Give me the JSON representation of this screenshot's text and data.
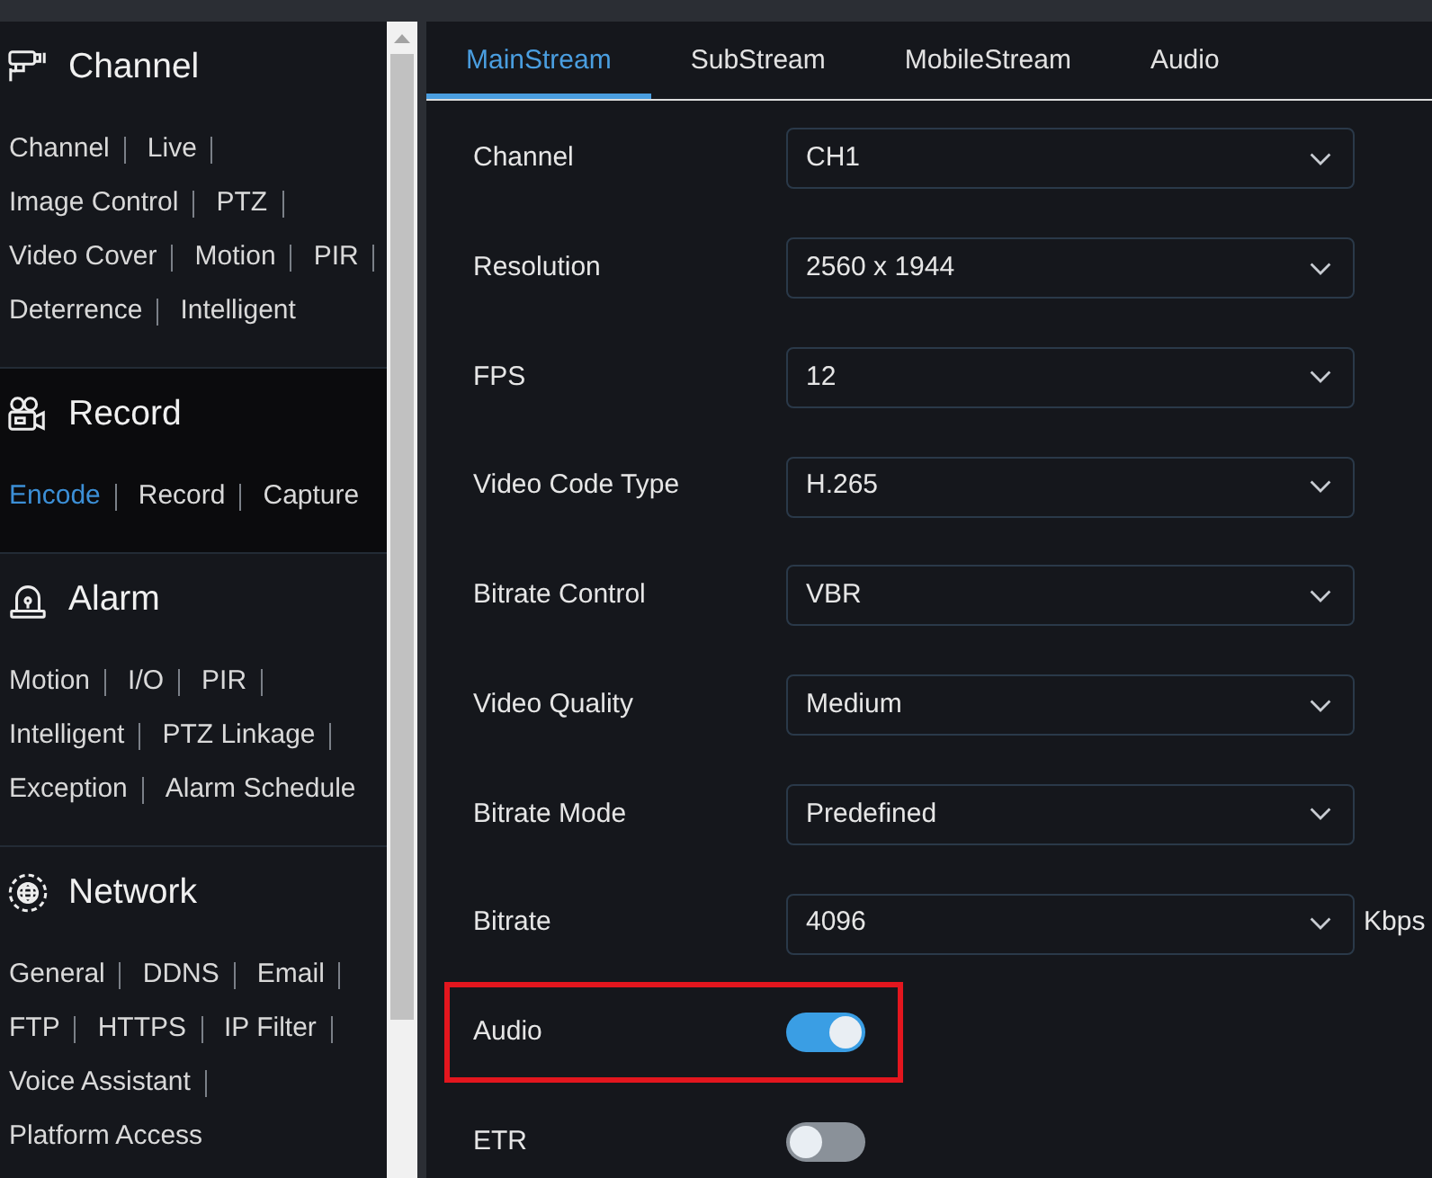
{
  "sidebar": {
    "sections": [
      {
        "kind": "channel",
        "title": "Channel",
        "selected": false,
        "lines": [
          [
            {
              "label": "Channel",
              "selected": false
            },
            {
              "label": "Live",
              "selected": false
            }
          ],
          [
            {
              "label": "Image Control",
              "selected": false
            },
            {
              "label": "PTZ",
              "selected": false
            }
          ],
          [
            {
              "label": "Video Cover",
              "selected": false
            },
            {
              "label": "Motion",
              "selected": false
            },
            {
              "label": "PIR",
              "selected": false
            }
          ],
          [
            {
              "label": "Deterrence",
              "selected": false
            },
            {
              "label": "Intelligent",
              "selected": false
            }
          ]
        ]
      },
      {
        "kind": "record",
        "title": "Record",
        "selected": true,
        "lines": [
          [
            {
              "label": "Encode",
              "selected": true
            },
            {
              "label": "Record",
              "selected": false
            },
            {
              "label": "Capture",
              "selected": false
            }
          ]
        ]
      },
      {
        "kind": "alarm",
        "title": "Alarm",
        "selected": false,
        "lines": [
          [
            {
              "label": "Motion",
              "selected": false
            },
            {
              "label": "I/O",
              "selected": false
            },
            {
              "label": "PIR",
              "selected": false
            }
          ],
          [
            {
              "label": "Intelligent",
              "selected": false
            },
            {
              "label": "PTZ Linkage",
              "selected": false
            }
          ],
          [
            {
              "label": "Exception",
              "selected": false
            },
            {
              "label": "Alarm Schedule",
              "selected": false
            }
          ]
        ]
      },
      {
        "kind": "network",
        "title": "Network",
        "selected": false,
        "lines": [
          [
            {
              "label": "General",
              "selected": false
            },
            {
              "label": "DDNS",
              "selected": false
            },
            {
              "label": "Email",
              "selected": false
            }
          ],
          [
            {
              "label": "FTP",
              "selected": false
            },
            {
              "label": "HTTPS",
              "selected": false
            },
            {
              "label": "IP Filter",
              "selected": false
            }
          ],
          [
            {
              "label": "Voice Assistant",
              "selected": false
            }
          ],
          [
            {
              "label": "Platform Access",
              "selected": false
            }
          ]
        ]
      }
    ]
  },
  "tabs": [
    {
      "label": "MainStream",
      "selected": true
    },
    {
      "label": "SubStream",
      "selected": false
    },
    {
      "label": "MobileStream",
      "selected": false
    },
    {
      "label": "Audio",
      "selected": false
    }
  ],
  "fields": [
    {
      "kind": "select",
      "label": "Channel",
      "value": "CH1",
      "highlighted": false
    },
    {
      "kind": "select",
      "label": "Resolution",
      "value": "2560 x 1944",
      "highlighted": false
    },
    {
      "kind": "select",
      "label": "FPS",
      "value": "12",
      "highlighted": false
    },
    {
      "kind": "select",
      "label": "Video Code Type",
      "value": "H.265",
      "highlighted": false
    },
    {
      "kind": "select",
      "label": "Bitrate Control",
      "value": "VBR",
      "highlighted": false
    },
    {
      "kind": "select",
      "label": "Video Quality",
      "value": "Medium",
      "highlighted": false
    },
    {
      "kind": "select",
      "label": "Bitrate Mode",
      "value": "Predefined",
      "highlighted": false
    },
    {
      "kind": "select",
      "label": "Bitrate",
      "value": "4096",
      "unit": "Kbps",
      "highlighted": false
    },
    {
      "kind": "toggle",
      "label": "Audio",
      "on": true,
      "highlighted": true
    },
    {
      "kind": "toggle",
      "label": "ETR",
      "on": false,
      "highlighted": false
    }
  ]
}
